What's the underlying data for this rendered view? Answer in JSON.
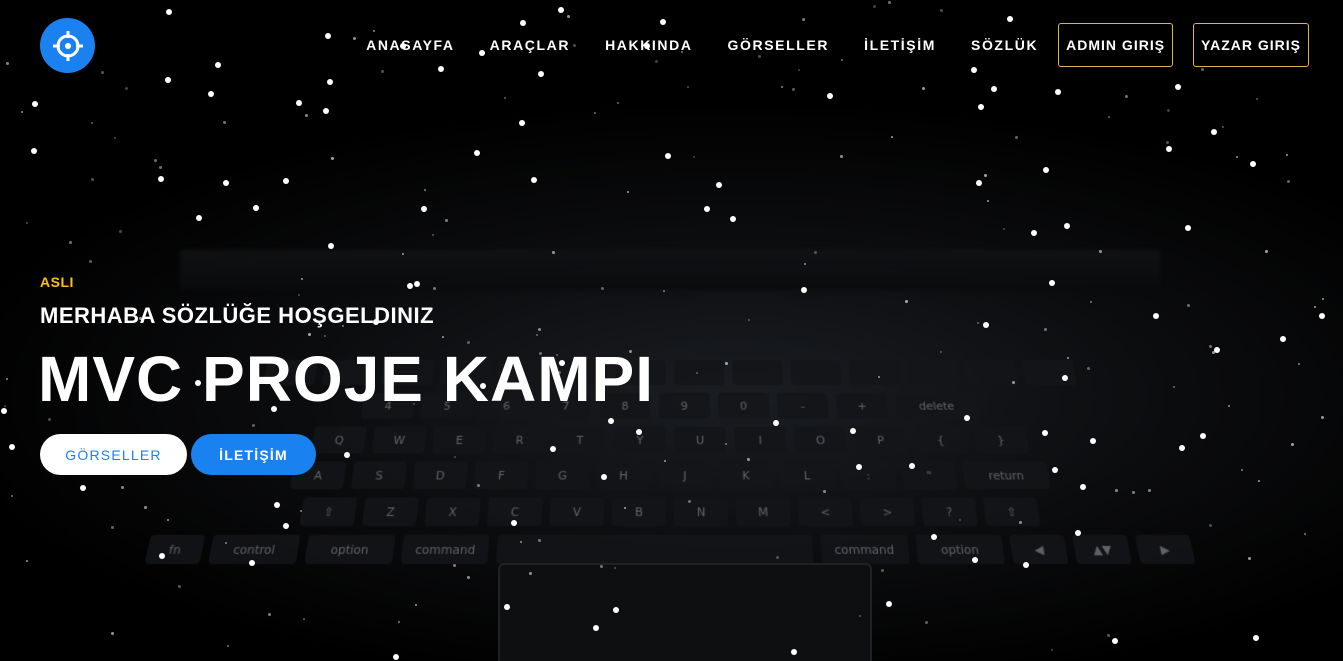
{
  "brand": {
    "logo_icon": "crosshair-target-icon",
    "accent": "#1a82f0"
  },
  "nav": {
    "links": [
      "ANASAYFA",
      "ARAÇLAR",
      "HAKKINDA",
      "GÖRSELLER",
      "İLETİŞİM",
      "SÖZLÜK"
    ],
    "admin_login": "ADMIN GIRIŞ",
    "author_login": "YAZAR GIRIŞ",
    "button_border_color": "#d9b54a"
  },
  "hero": {
    "eyebrow": "ASLI",
    "eyebrow_color": "#ffc107",
    "subtitle": "MERHABA SÖZLÜĞE HOŞGELDINIZ",
    "title": "MVC PROJE KAMPI",
    "buttons": {
      "gallery": "GÖRSELLER",
      "contact": "İLETİŞİM"
    }
  },
  "keyboard": {
    "rows": [
      [
        "",
        "",
        "",
        "",
        "",
        "",
        "",
        "",
        "",
        "",
        "",
        "",
        "",
        ""
      ],
      [
        "4",
        "5",
        "6",
        "7",
        "8",
        "9",
        "0",
        "-",
        "+",
        "delete"
      ],
      [
        "Q",
        "W",
        "E",
        "R",
        "T",
        "Y",
        "U",
        "I",
        "O",
        "P",
        "{",
        "}"
      ],
      [
        "A",
        "S",
        "D",
        "F",
        "G",
        "H",
        "J",
        "K",
        "L",
        ":",
        "\"",
        "return"
      ],
      [
        "⇧",
        "Z",
        "X",
        "C",
        "V",
        "B",
        "N",
        "M",
        "<",
        ">",
        "?",
        "⇧"
      ],
      [
        "fn",
        "control",
        "option",
        "command",
        "",
        "command",
        "option",
        "◀",
        "▲▼",
        "▶"
      ]
    ]
  }
}
